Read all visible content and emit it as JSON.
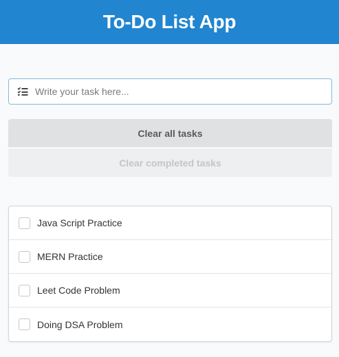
{
  "header": {
    "title": "To-Do List App"
  },
  "task_input": {
    "icon": "tasks-list-icon",
    "placeholder": "Write your task here...",
    "value": ""
  },
  "buttons": {
    "clear_all": "Clear all tasks",
    "clear_completed": "Clear completed tasks"
  },
  "tasks": [
    {
      "label": "Java Script Practice",
      "completed": false
    },
    {
      "label": "MERN Practice",
      "completed": false
    },
    {
      "label": "Leet Code Problem",
      "completed": false
    },
    {
      "label": "Doing DSA Problem",
      "completed": false
    }
  ],
  "colors": {
    "header_bg": "#2185d0",
    "input_border": "#85b7d9"
  }
}
